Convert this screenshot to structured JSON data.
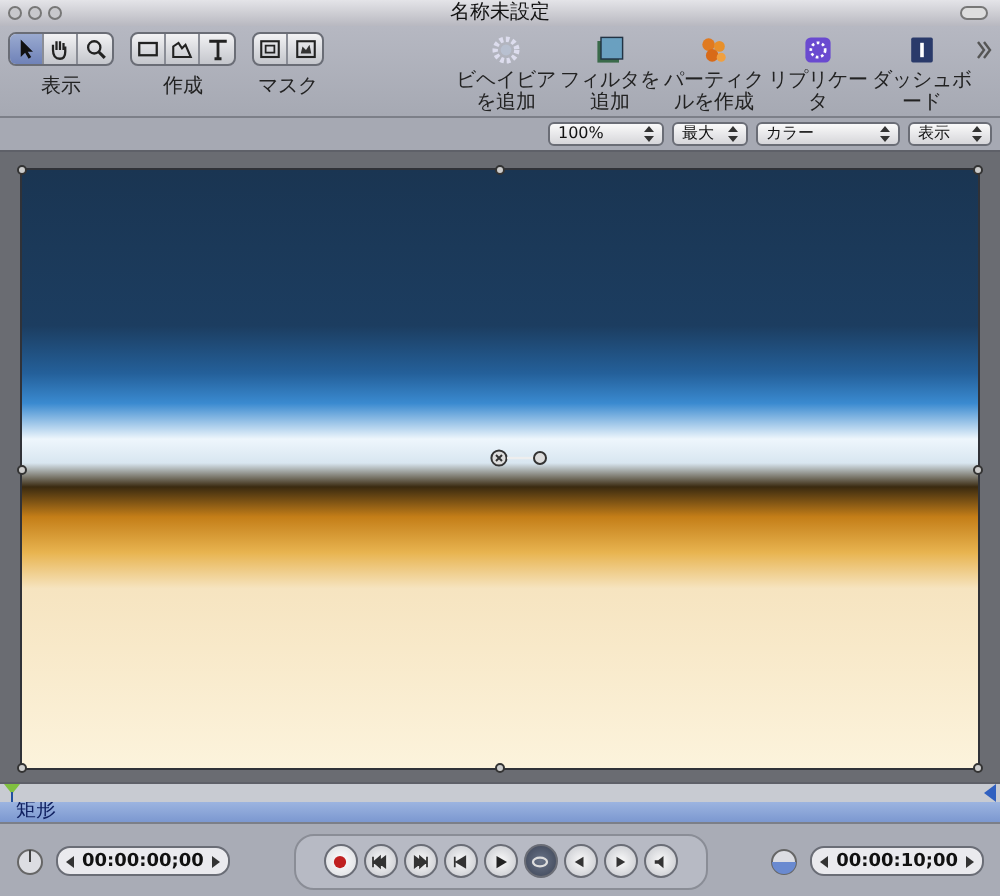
{
  "window": {
    "title": "名称未設定"
  },
  "tool_groups": [
    {
      "label": "表示",
      "tools": [
        {
          "kind": "arrow",
          "selected": true
        },
        {
          "kind": "hand",
          "selected": false
        },
        {
          "kind": "zoom",
          "selected": false
        }
      ]
    },
    {
      "label": "作成",
      "tools": [
        {
          "kind": "rectangle",
          "selected": false
        },
        {
          "kind": "shape",
          "selected": false
        },
        {
          "kind": "text",
          "selected": false
        }
      ]
    },
    {
      "label": "マスク",
      "tools": [
        {
          "kind": "mask-rect",
          "selected": false
        },
        {
          "kind": "mask-shape",
          "selected": false
        }
      ]
    }
  ],
  "actions": [
    {
      "kind": "gear",
      "label": "ビヘイビアを追加"
    },
    {
      "kind": "filter",
      "label": "フィルタを追加"
    },
    {
      "kind": "particles",
      "label": "パーティクルを作成"
    },
    {
      "kind": "replicator",
      "label": "リプリケータ"
    },
    {
      "kind": "dashboard",
      "label": "ダッシュボード"
    }
  ],
  "popups": [
    {
      "value": "100%"
    },
    {
      "value": "最大"
    },
    {
      "value": "カラー"
    },
    {
      "value": "表示"
    }
  ],
  "timeline": {
    "layer": "矩形",
    "start_time": "00:00:00;00",
    "end_time": "00:00:10;00"
  },
  "transport": [
    {
      "kind": "record",
      "on": true
    },
    {
      "kind": "start",
      "on": false
    },
    {
      "kind": "end",
      "on": false
    },
    {
      "kind": "prev",
      "on": false
    },
    {
      "kind": "play",
      "on": false
    },
    {
      "kind": "loop",
      "on": true
    },
    {
      "kind": "back",
      "on": false
    },
    {
      "kind": "forward",
      "on": false
    },
    {
      "kind": "audio",
      "on": false
    }
  ]
}
